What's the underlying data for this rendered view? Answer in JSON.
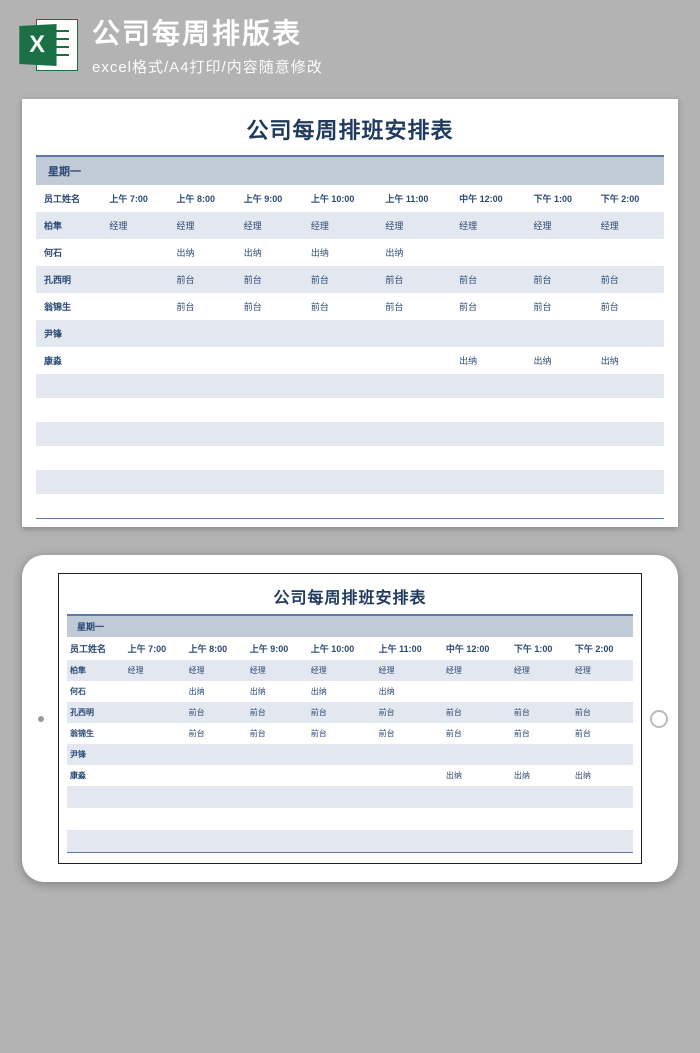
{
  "header": {
    "title": "公司每周排版表",
    "subtitle": "excel格式/A4打印/内容随意修改",
    "icon_letter": "X"
  },
  "sheet": {
    "title": "公司每周排班安排表",
    "day_label": "星期一",
    "columns": [
      "员工姓名",
      "上午 7:00",
      "上午 8:00",
      "上午 9:00",
      "上午 10:00",
      "上午 11:00",
      "中午 12:00",
      "下午 1:00",
      "下午 2:00"
    ],
    "rows": [
      {
        "name": "柏隼",
        "cells": [
          "经理",
          "经理",
          "经理",
          "经理",
          "经理",
          "经理",
          "经理",
          "经理"
        ]
      },
      {
        "name": "何石",
        "cells": [
          "",
          "出纳",
          "出纳",
          "出纳",
          "出纳",
          "",
          "",
          ""
        ]
      },
      {
        "name": "孔西明",
        "cells": [
          "",
          "前台",
          "前台",
          "前台",
          "前台",
          "前台",
          "前台",
          "前台"
        ]
      },
      {
        "name": "翁锦生",
        "cells": [
          "",
          "前台",
          "前台",
          "前台",
          "前台",
          "前台",
          "前台",
          "前台"
        ]
      },
      {
        "name": "尹锋",
        "cells": [
          "",
          "",
          "",
          "",
          "",
          "",
          "",
          ""
        ]
      },
      {
        "name": "康淼",
        "cells": [
          "",
          "",
          "",
          "",
          "",
          "出纳",
          "出纳",
          "出纳"
        ]
      }
    ]
  }
}
